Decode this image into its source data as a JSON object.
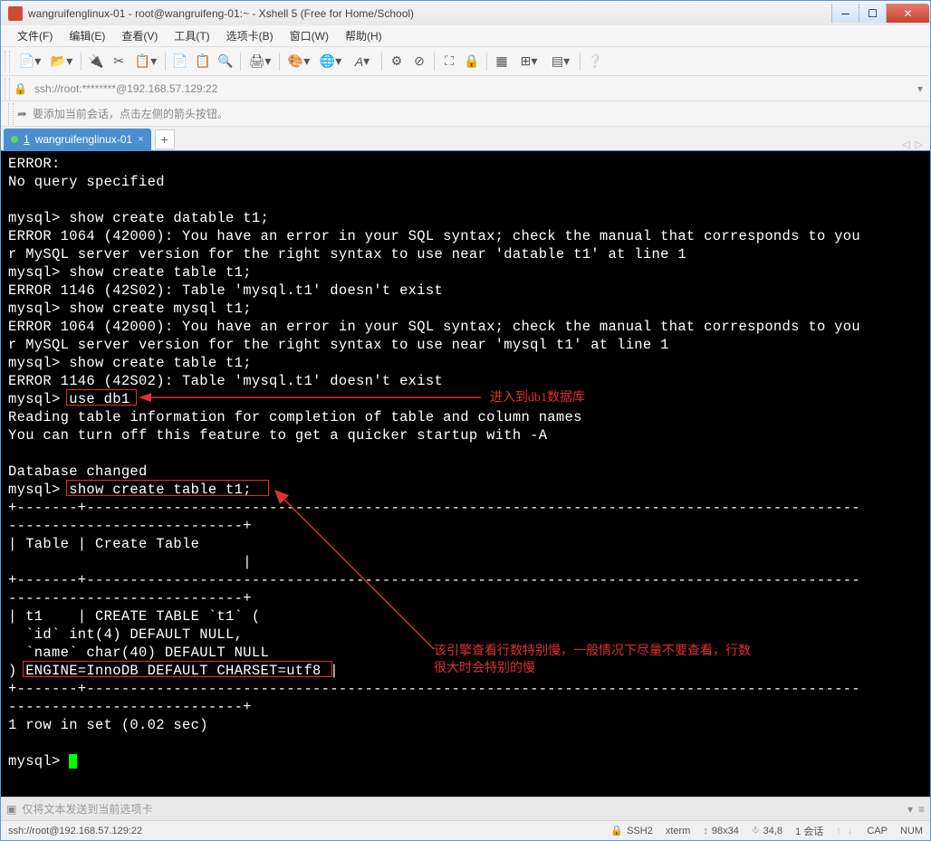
{
  "window": {
    "title": "wangruifenglinux-01 - root@wangruifeng-01:~ - Xshell 5 (Free for Home/School)"
  },
  "menu": {
    "file": "文件(F)",
    "edit": "编辑(E)",
    "view": "查看(V)",
    "tools": "工具(T)",
    "option": "选项卡(B)",
    "window": "窗口(W)",
    "help": "帮助(H)"
  },
  "addressbar": {
    "lock": "🔒",
    "text": "ssh://root:********@192.168.57.129:22"
  },
  "infobar": {
    "text": "要添加当前会话，点击左侧的箭头按钮。"
  },
  "tab": {
    "num": "1",
    "title": "wangruifenglinux-01",
    "close": "×",
    "new": "+"
  },
  "terminal": {
    "l01": "ERROR:",
    "l02": "No query specified",
    "l03": "",
    "l04": "mysql> show create datable t1;",
    "l05": "ERROR 1064 (42000): You have an error in your SQL syntax; check the manual that corresponds to you",
    "l06": "r MySQL server version for the right syntax to use near 'datable t1' at line 1",
    "l07": "mysql> show create table t1;",
    "l08": "ERROR 1146 (42S02): Table 'mysql.t1' doesn't exist",
    "l09": "mysql> show create mysql t1;",
    "l10": "ERROR 1064 (42000): You have an error in your SQL syntax; check the manual that corresponds to you",
    "l11": "r MySQL server version for the right syntax to use near 'mysql t1' at line 1",
    "l12": "mysql> show create table t1;",
    "l13": "ERROR 1146 (42S02): Table 'mysql.t1' doesn't exist",
    "l14a": "mysql> ",
    "l14b": "use db1",
    "l15": "Reading table information for completion of table and column names",
    "l16": "You can turn off this feature to get a quicker startup with -A",
    "l17": "",
    "l18": "Database changed",
    "l19a": "mysql> ",
    "l19b": "show create table t1;",
    "l20": "+-------+-----------------------------------------------------------------------------------------",
    "l21": "---------------------------+",
    "l22": "| Table | Create Table                                                                            ",
    "l23": "                           |",
    "l24": "+-------+-----------------------------------------------------------------------------------------",
    "l25": "---------------------------+",
    "l26": "| t1    | CREATE TABLE `t1` (",
    "l27": "  `id` int(4) DEFAULT NULL,",
    "l28": "  `name` char(40) DEFAULT NULL",
    "l29a": ") ",
    "l29b": "ENGINE=InnoDB DEFAULT CHARSET=utf8",
    "l29c": " |",
    "l30": "+-------+-----------------------------------------------------------------------------------------",
    "l31": "---------------------------+",
    "l32": "1 row in set (0.02 sec)",
    "l33": "",
    "l34": "mysql> "
  },
  "annotations": {
    "a1": "进入到db1数据库",
    "a2": "该引擎查看行数特别慢，一般情况下尽量不要查看，行数",
    "a3": "很大时会特别的慢"
  },
  "inputbar": {
    "placeholder": "仅将文本发送到当前选项卡"
  },
  "statusbar": {
    "conn": "ssh://root@192.168.57.129:22",
    "proto": "SSH2",
    "term": "xterm",
    "size": "98x34",
    "pos": "34,8",
    "sessions": "1 会话",
    "caps": "CAP",
    "num": "NUM"
  }
}
